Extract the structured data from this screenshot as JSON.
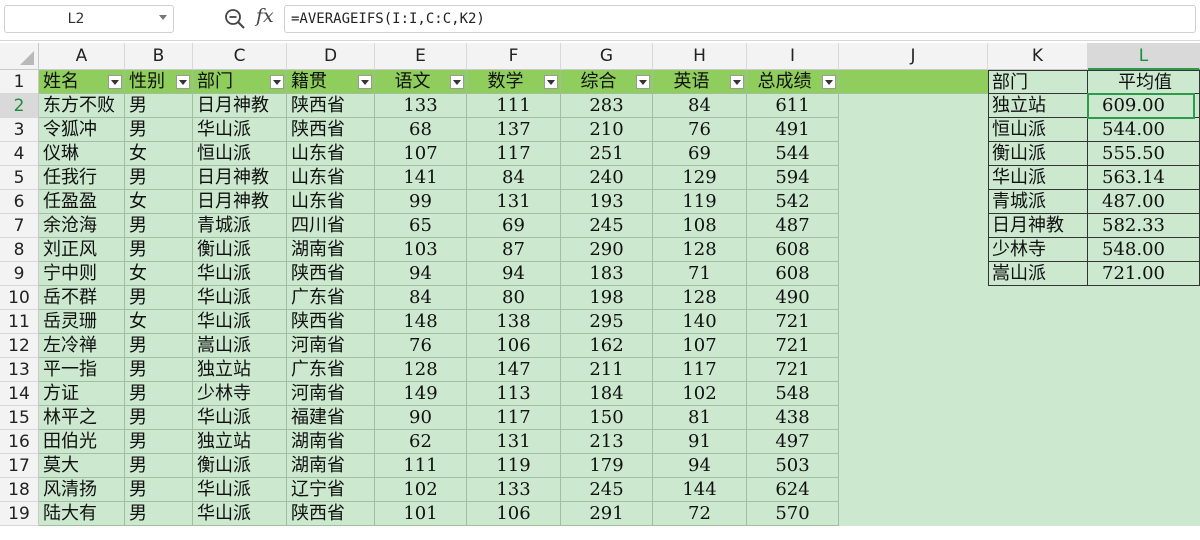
{
  "formula_bar": {
    "name_box": "L2",
    "zoom_icon": "zoom-icon",
    "fx_label": "fx",
    "formula": "=AVERAGEIFS(I:I,C:C,K2)"
  },
  "colors": {
    "table_fill": "#cce8cf",
    "header_fill": "#8fce5c",
    "selected_border": "#2e9a4b",
    "gridline": "#9fbf9f"
  },
  "columns": [
    "A",
    "B",
    "C",
    "D",
    "E",
    "F",
    "G",
    "H",
    "I",
    "J",
    "K",
    "L"
  ],
  "selected_column": "L",
  "rows": [
    "1",
    "2",
    "3",
    "4",
    "5",
    "6",
    "7",
    "8",
    "9",
    "10",
    "11",
    "12",
    "13",
    "14",
    "15",
    "16",
    "17",
    "18",
    "19"
  ],
  "selected_row": "2",
  "table": {
    "headers": [
      "姓名",
      "性别",
      "部门",
      "籍贯",
      "语文",
      "数学",
      "综合",
      "英语",
      "总成绩"
    ],
    "rows": [
      [
        "东方不败",
        "男",
        "日月神教",
        "陕西省",
        "133",
        "111",
        "283",
        "84",
        "611"
      ],
      [
        "令狐冲",
        "男",
        "华山派",
        "陕西省",
        "68",
        "137",
        "210",
        "76",
        "491"
      ],
      [
        "仪琳",
        "女",
        "恒山派",
        "山东省",
        "107",
        "117",
        "251",
        "69",
        "544"
      ],
      [
        "任我行",
        "男",
        "日月神教",
        "山东省",
        "141",
        "84",
        "240",
        "129",
        "594"
      ],
      [
        "任盈盈",
        "女",
        "日月神教",
        "山东省",
        "99",
        "131",
        "193",
        "119",
        "542"
      ],
      [
        "余沧海",
        "男",
        "青城派",
        "四川省",
        "65",
        "69",
        "245",
        "108",
        "487"
      ],
      [
        "刘正风",
        "男",
        "衡山派",
        "湖南省",
        "103",
        "87",
        "290",
        "128",
        "608"
      ],
      [
        "宁中则",
        "女",
        "华山派",
        "陕西省",
        "94",
        "94",
        "183",
        "71",
        "608"
      ],
      [
        "岳不群",
        "男",
        "华山派",
        "广东省",
        "84",
        "80",
        "198",
        "128",
        "490"
      ],
      [
        "岳灵珊",
        "女",
        "华山派",
        "陕西省",
        "148",
        "138",
        "295",
        "140",
        "721"
      ],
      [
        "左冷禅",
        "男",
        "嵩山派",
        "河南省",
        "76",
        "106",
        "162",
        "107",
        "721"
      ],
      [
        "平一指",
        "男",
        "独立站",
        "广东省",
        "128",
        "147",
        "211",
        "117",
        "721"
      ],
      [
        "方证",
        "男",
        "少林寺",
        "河南省",
        "149",
        "113",
        "184",
        "102",
        "548"
      ],
      [
        "林平之",
        "男",
        "华山派",
        "福建省",
        "90",
        "117",
        "150",
        "81",
        "438"
      ],
      [
        "田伯光",
        "男",
        "独立站",
        "湖南省",
        "62",
        "131",
        "213",
        "91",
        "497"
      ],
      [
        "莫大",
        "男",
        "衡山派",
        "湖南省",
        "111",
        "119",
        "179",
        "94",
        "503"
      ],
      [
        "风清扬",
        "男",
        "华山派",
        "辽宁省",
        "102",
        "133",
        "245",
        "144",
        "624"
      ],
      [
        "陆大有",
        "男",
        "华山派",
        "陕西省",
        "101",
        "106",
        "291",
        "72",
        "570"
      ]
    ]
  },
  "summary": {
    "headers": [
      "部门",
      "平均值"
    ],
    "rows": [
      [
        "独立站",
        "609.00"
      ],
      [
        "恒山派",
        "544.00"
      ],
      [
        "衡山派",
        "555.50"
      ],
      [
        "华山派",
        "563.14"
      ],
      [
        "青城派",
        "487.00"
      ],
      [
        "日月神教",
        "582.33"
      ],
      [
        "少林寺",
        "548.00"
      ],
      [
        "嵩山派",
        "721.00"
      ]
    ]
  }
}
